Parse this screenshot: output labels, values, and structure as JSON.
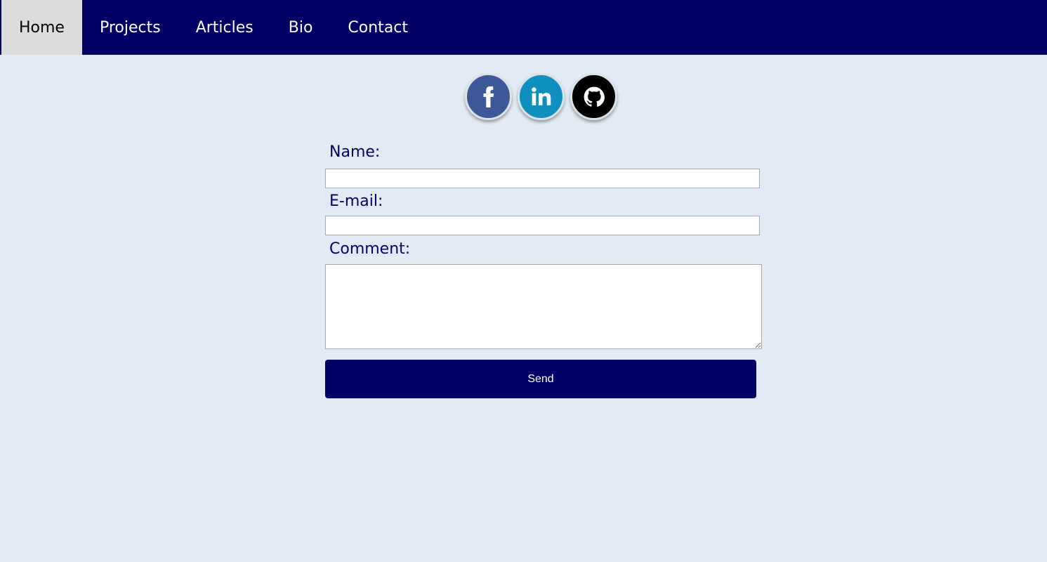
{
  "nav": {
    "items": [
      {
        "label": "Home",
        "active": true
      },
      {
        "label": "Projects"
      },
      {
        "label": "Articles"
      },
      {
        "label": "Bio"
      },
      {
        "label": "Contact"
      }
    ]
  },
  "socials": [
    {
      "icon": "facebook-icon",
      "color": "#3b5998"
    },
    {
      "icon": "linkedin-icon",
      "color": "#0e8fbd"
    },
    {
      "icon": "github-icon",
      "color": "#000000"
    }
  ],
  "form": {
    "name_label": "Name:",
    "name_value": "",
    "email_label": "E-mail:",
    "email_value": "",
    "comment_label": "Comment:",
    "comment_value": "",
    "send_label": "Send"
  },
  "colors": {
    "nav_bg": "#000066",
    "page_bg": "#e2ebf5",
    "active_tab": "#dcdcdc",
    "button_bg": "#000066",
    "label_text": "#000066"
  }
}
